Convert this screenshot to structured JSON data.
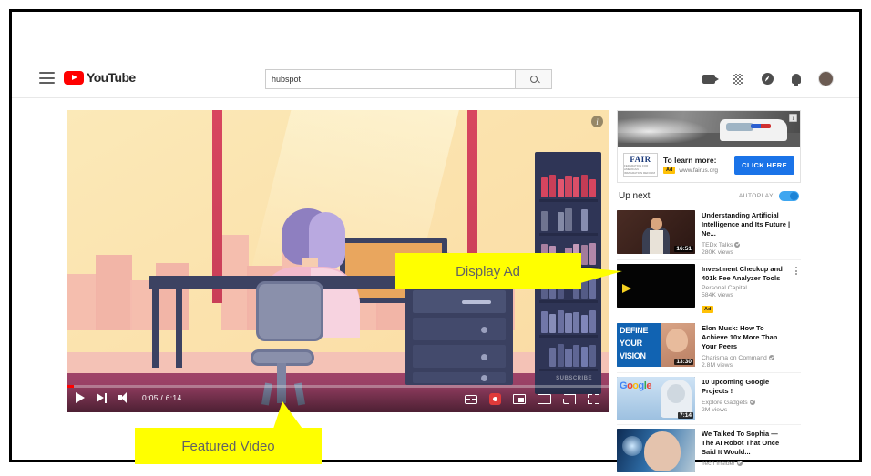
{
  "browser": {
    "site": "YouTube"
  },
  "header": {
    "menu_label": "Menu",
    "logo_text": "YouTube",
    "search": {
      "value": "hubspot",
      "placeholder": "Search",
      "button_label": "Search"
    },
    "icons": [
      {
        "name": "create-video-icon",
        "label": "Create"
      },
      {
        "name": "apps-grid-icon",
        "label": "YouTube apps"
      },
      {
        "name": "messages-icon",
        "label": "Messages"
      },
      {
        "name": "notifications-bell-icon",
        "label": "Notifications"
      },
      {
        "name": "account-avatar",
        "label": "Account"
      }
    ]
  },
  "player": {
    "info_badge": "i",
    "subscribe_watermark": "SUBSCRIBE",
    "current_time": "0:05",
    "duration": "6:14",
    "time_display": "0:05 / 6:14",
    "progress_percent": 1.3,
    "controls": {
      "play_label": "Play",
      "next_label": "Next",
      "volume_label": "Volume",
      "captions_label": "Subtitles/closed captions",
      "settings_label": "Settings",
      "miniplayer_label": "Miniplayer",
      "theater_label": "Theater mode",
      "cast_label": "Play on TV",
      "fullscreen_label": "Full screen"
    }
  },
  "sidebar": {
    "display_ad": {
      "advertiser": "FAIR",
      "advertiser_sub": "FEDERATION FOR AMERICAN IMMIGRATION REFORM",
      "headline": "To learn more:",
      "ad_tag": "Ad",
      "url": "www.fairus.org",
      "cta": "CLICK HERE",
      "info_badge": "i",
      "cta_color": "#1a73e8"
    },
    "up_next_label": "Up next",
    "autoplay_label": "AUTOPLAY",
    "autoplay_on": true,
    "autoplay_color": "#3ea6f0",
    "videos": [
      {
        "title": "Understanding Artificial Intelligence and Its Future | Ne...",
        "channel": "TEDx Talks",
        "verified": true,
        "views": "280K views",
        "duration": "16:51",
        "is_ad": false,
        "thumb": "ted"
      },
      {
        "title": "Investment Checkup and 401k Fee Analyzer Tools",
        "channel": "Personal Capital",
        "verified": false,
        "views": "584K views",
        "duration": "",
        "is_ad": true,
        "ad_badge": "Ad",
        "thumb": "black"
      },
      {
        "title": "Elon Musk: How To Achieve 10x More Than Your Peers",
        "channel": "Charisma on Command",
        "verified": true,
        "views": "2.8M views",
        "duration": "13:30",
        "is_ad": false,
        "thumb": "vision",
        "thumb_text": [
          "DEFINE",
          "YOUR",
          "VISION"
        ]
      },
      {
        "title": "10 upcoming Google Projects !",
        "channel": "Explore Gadgets",
        "verified": true,
        "views": "2M views",
        "duration": "7:14",
        "is_ad": false,
        "thumb": "google",
        "thumb_text": [
          "Google"
        ]
      },
      {
        "title": "We Talked To Sophia — The AI Robot That Once Said It Would...",
        "channel": "Tech Insider",
        "verified": true,
        "views": "",
        "duration": "",
        "is_ad": false,
        "thumb": "sophia"
      }
    ]
  },
  "annotations": {
    "display_ad": "Display Ad",
    "featured_video": "Featured Video",
    "highlight_color": "#ffff00"
  }
}
